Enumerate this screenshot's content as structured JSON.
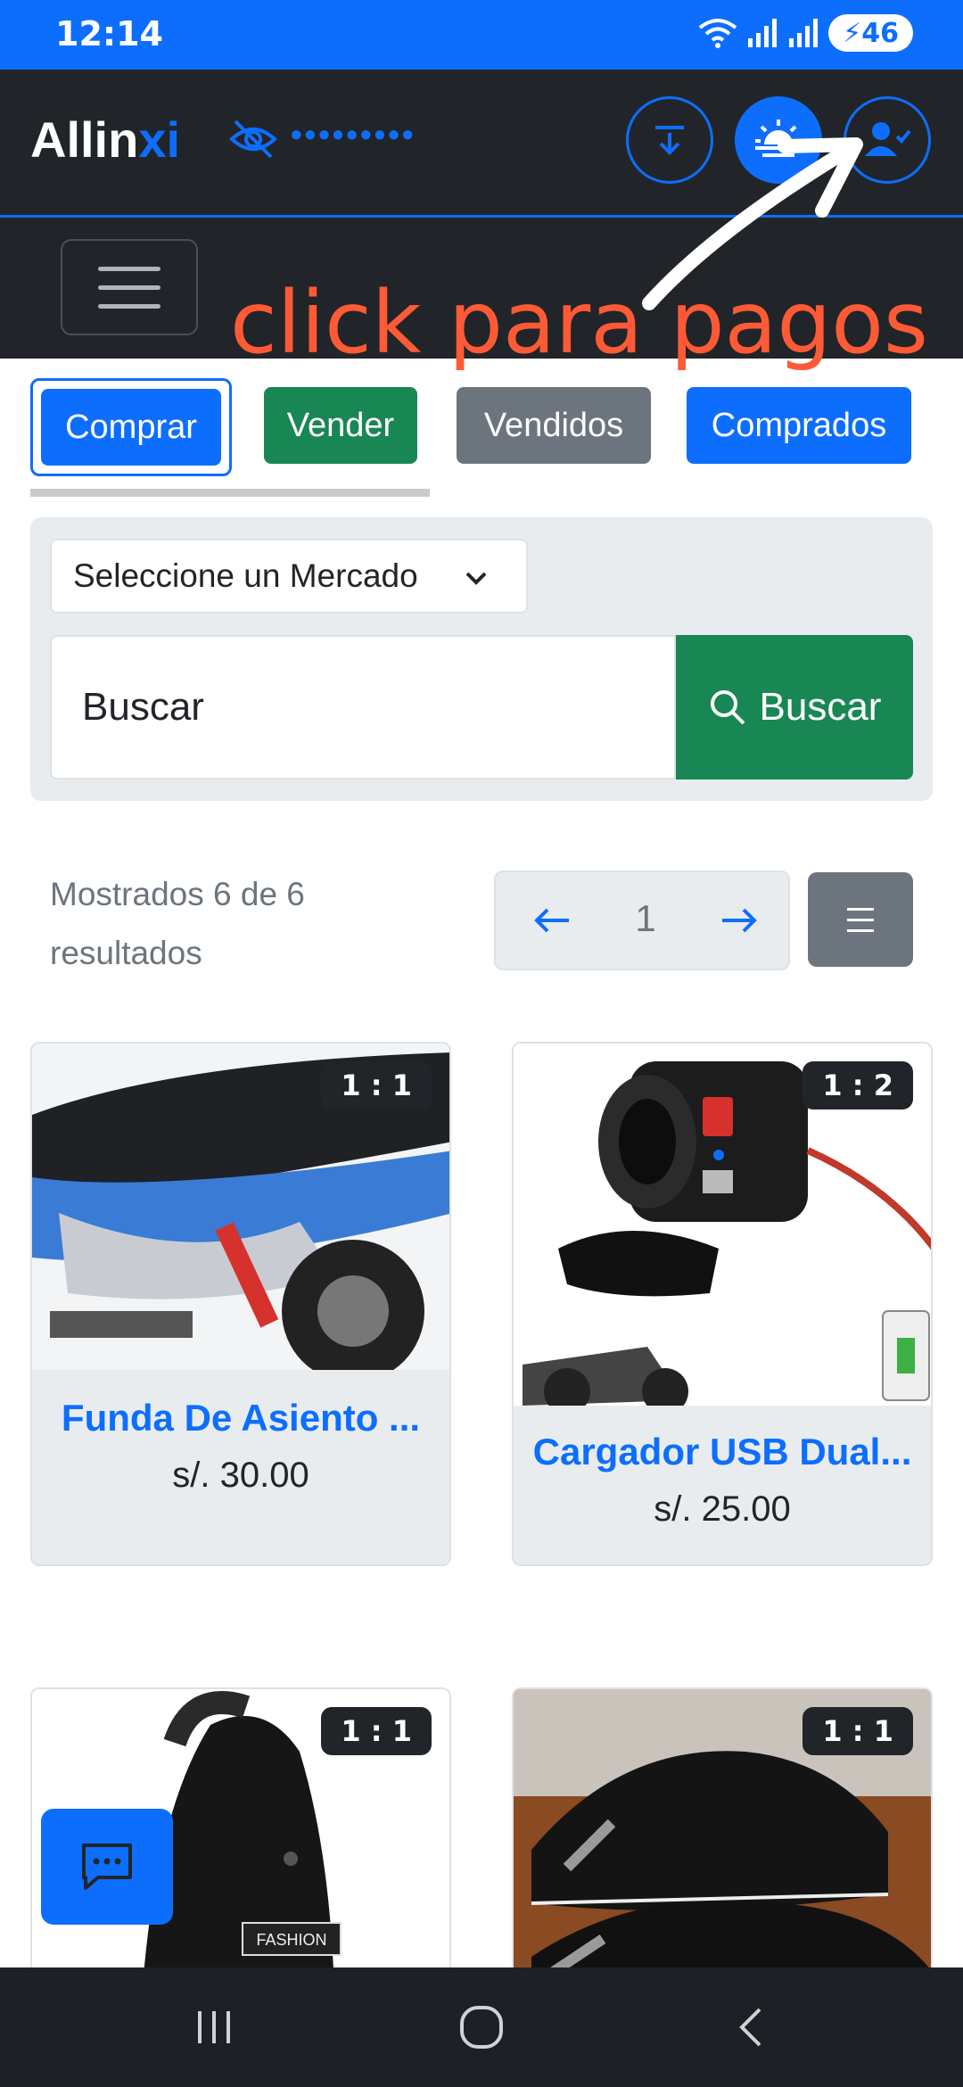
{
  "status_bar": {
    "time": "12:14",
    "battery": "46"
  },
  "navbar": {
    "brand_part1": "Allin",
    "brand_part2": "xi",
    "hidden_balance": "•••••••••"
  },
  "annotation": {
    "text": "click para pagos"
  },
  "tabs": [
    {
      "label": "Comprar",
      "active": true,
      "color": "#0d6efd"
    },
    {
      "label": "Vender",
      "color": "#198754"
    },
    {
      "label": "Vendidos",
      "color": "#6c757d"
    },
    {
      "label": "Comprados",
      "color": "#0d6efd"
    }
  ],
  "search": {
    "market_select": "Seleccione un Mercado",
    "input_value": "Buscar",
    "button_label": "Buscar"
  },
  "results": {
    "text": "Mostrados 6 de 6 resultados",
    "page": "1"
  },
  "products": [
    {
      "title": "Funda De Asiento ...",
      "price": "s/. 30.00",
      "badge": "1 : 1"
    },
    {
      "title": "Cargador USB Dual...",
      "price": "s/. 25.00",
      "badge": "1 : 2"
    },
    {
      "badge": "1 : 1",
      "image_label": "FASHION"
    },
    {
      "badge": "1 : 1"
    }
  ],
  "colors": {
    "primary": "#0d6efd",
    "success": "#198754",
    "secondary": "#6c757d",
    "dark": "#212529",
    "annotation": "#ff5a36"
  }
}
